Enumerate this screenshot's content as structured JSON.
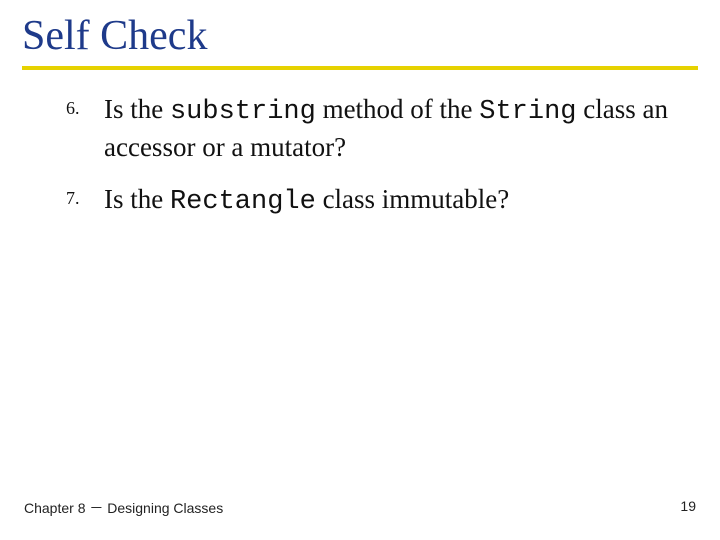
{
  "title": "Self Check",
  "items": [
    {
      "num": "6.",
      "pre1": "Is the ",
      "code1": "substring",
      "mid1": " method of the ",
      "code2": "String",
      "post1": " class an accessor or a mutator?"
    },
    {
      "num": "7.",
      "pre1": "Is the ",
      "code1": "Rectangle",
      "mid1": " class immutable?",
      "code2": "",
      "post1": ""
    }
  ],
  "footer": {
    "left": "Chapter 8 － Designing Classes",
    "right": "19"
  }
}
